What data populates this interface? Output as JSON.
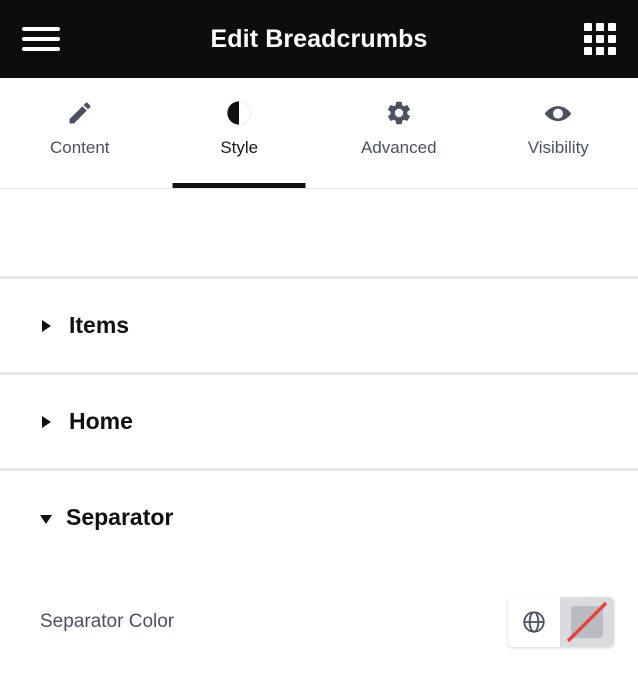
{
  "header": {
    "title": "Edit Breadcrumbs",
    "menu_icon": "hamburger-menu-icon",
    "apps_icon": "apps-grid-icon",
    "background": "#0d0d0d"
  },
  "tabs": [
    {
      "label": "Content",
      "icon": "pencil-icon",
      "active": false
    },
    {
      "label": "Style",
      "icon": "contrast-half-circle-icon",
      "active": true
    },
    {
      "label": "Advanced",
      "icon": "gear-icon",
      "active": false
    },
    {
      "label": "Visibility",
      "icon": "eye-icon",
      "active": false
    }
  ],
  "sections": [
    {
      "title": "Items",
      "expanded": false
    },
    {
      "title": "Home",
      "expanded": false
    },
    {
      "title": "Separator",
      "expanded": true
    }
  ],
  "separator_controls": {
    "color_label": "Separator Color",
    "globe_icon": "globe-icon",
    "swatch_icon": "no-color-swatch-icon",
    "swatch_state": "none",
    "slash_color": "#ea4335"
  },
  "colors": {
    "accent": "#101010",
    "tab_inactive_text": "#4a5162",
    "divider": "#e8e8e8"
  }
}
